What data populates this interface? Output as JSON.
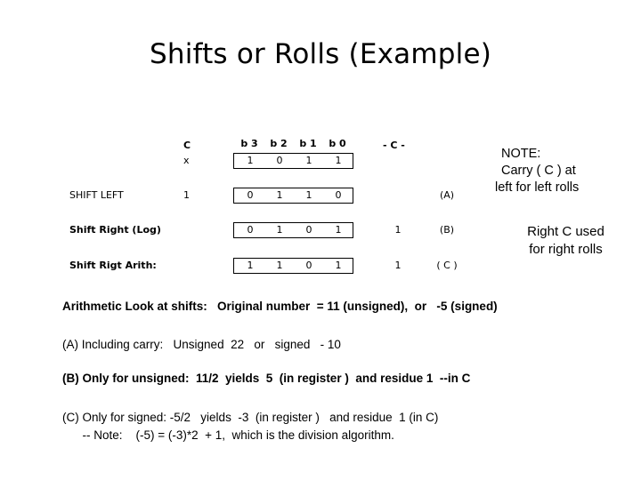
{
  "slide": {
    "title": "Shifts or Rolls (Example)",
    "background_color": "#ffffff",
    "text_color": "#000000"
  },
  "table": {
    "headers": {
      "carry_left": "C",
      "bit_labels": [
        "b 3",
        "b 2",
        "b 1",
        "b 0"
      ],
      "carry_right": "- C -"
    },
    "rows": [
      {
        "label": "",
        "carry_left": "x",
        "bits": [
          "1",
          "0",
          "1",
          "1"
        ],
        "carry_right": "",
        "tag": ""
      },
      {
        "label": "SHIFT LEFT",
        "carry_left": "1",
        "bits": [
          "0",
          "1",
          "1",
          "0"
        ],
        "carry_right": "",
        "tag": "(A)"
      },
      {
        "label": "Shift Right (Log)",
        "carry_left": "",
        "bits": [
          "0",
          "1",
          "0",
          "1"
        ],
        "carry_right": "1",
        "tag": "(B)"
      },
      {
        "label": "Shift Rigt Arith:",
        "carry_left": "",
        "bits": [
          "1",
          "1",
          "0",
          "1"
        ],
        "carry_right": "1",
        "tag": "( C )"
      }
    ]
  },
  "note": {
    "heading": "NOTE:",
    "line2": "Carry ( C ) at",
    "line3": "left for left rolls",
    "second_line1": "Right  C  used",
    "second_line2": "for right rolls"
  },
  "body": {
    "line1": "Arithmetic Look at shifts:   Original number  = 11 (unsigned),  or   -5 (signed)",
    "line2": "(A) Including carry:   Unsigned  22   or   signed   - 10",
    "line3": "(B) Only for unsigned:  11/2  yields  5  (in register )  and residue 1  --in C",
    "line4": "(C) Only for signed: -5/2   yields  -3  (in register )   and residue  1 (in C)",
    "line5": "      -- Note:    (-5) = (-3)*2  + 1,  which is the division algorithm."
  }
}
